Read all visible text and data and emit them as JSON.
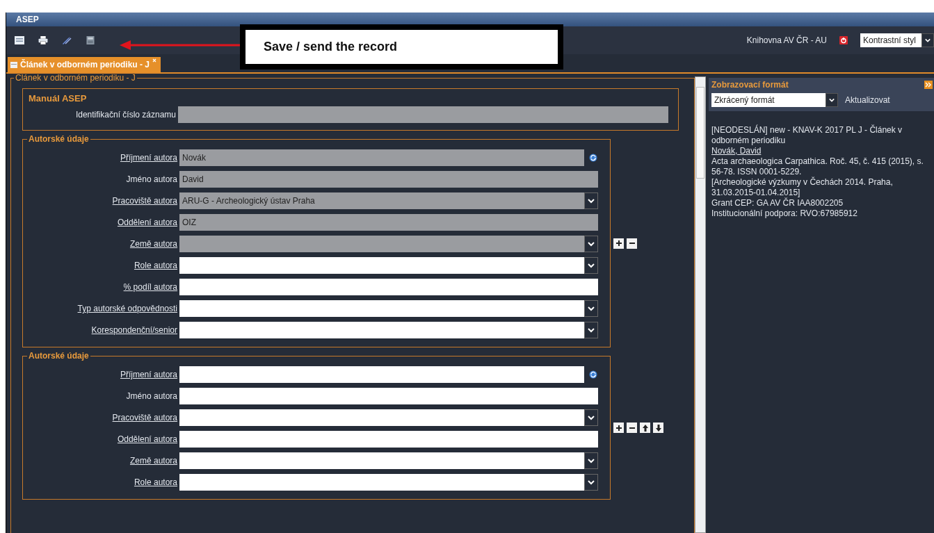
{
  "window": {
    "title": "ASEP"
  },
  "toolbar": {
    "library": "Knihovna AV ČR - AU",
    "style_select": {
      "value": "Kontrastní styl"
    }
  },
  "annotation": {
    "text": "Save / send the record"
  },
  "tabs": [
    {
      "label": "Článek v odborném periodiku - J",
      "selected": true
    }
  ],
  "form": {
    "title": "Článek v odborném periodiku - J",
    "manual": {
      "heading": "Manuál ASEP",
      "fields": [
        {
          "label": "Identifikační číslo záznamu",
          "kind": "text",
          "link": false,
          "disabled": true
        }
      ]
    },
    "sections": [
      {
        "legend": "Autorské údaje",
        "actions": [
          {
            "kind": "add"
          },
          {
            "kind": "remove"
          }
        ],
        "fields": [
          {
            "label": "Příjmení autora",
            "value": "Novák",
            "kind": "lookup",
            "link": true,
            "disabled": true
          },
          {
            "label": "Jméno autora",
            "value": "David",
            "kind": "text",
            "link": false,
            "disabled": true
          },
          {
            "label": "Pracoviště autora",
            "value": "ARU-G - Archeologický ústav Praha",
            "kind": "select",
            "link": true,
            "disabled": true
          },
          {
            "label": "Oddělení autora",
            "value": "OIZ",
            "kind": "text",
            "link": true,
            "disabled": true
          },
          {
            "label": "Země autora",
            "kind": "select",
            "link": true,
            "disabled": true
          },
          {
            "label": "Role autora",
            "kind": "select",
            "link": true,
            "disabled": false
          },
          {
            "label": "% podíl autora",
            "kind": "text",
            "link": true,
            "disabled": false
          },
          {
            "label": "Typ autorské odpovědnosti",
            "kind": "select",
            "link": true,
            "disabled": false
          },
          {
            "label": "Korespondenční/senior",
            "kind": "select",
            "link": true,
            "disabled": false
          }
        ]
      },
      {
        "legend": "Autorské údaje",
        "actions": [
          {
            "kind": "add"
          },
          {
            "kind": "remove"
          },
          {
            "kind": "up"
          },
          {
            "kind": "down"
          }
        ],
        "fields": [
          {
            "label": "Příjmení autora",
            "kind": "lookup",
            "link": true,
            "disabled": false
          },
          {
            "label": "Jméno autora",
            "kind": "text",
            "link": false,
            "disabled": false
          },
          {
            "label": "Pracoviště autora",
            "kind": "select",
            "link": true,
            "disabled": false
          },
          {
            "label": "Oddělení autora",
            "kind": "text",
            "link": true,
            "disabled": false
          },
          {
            "label": "Země autora",
            "kind": "select",
            "link": true,
            "disabled": false
          },
          {
            "label": "Role autora",
            "kind": "select",
            "link": true,
            "disabled": false
          }
        ]
      }
    ]
  },
  "preview": {
    "title": "Zobrazovací formát",
    "format_select": {
      "value": "Zkrácený formát"
    },
    "update_button": "Aktualizovat",
    "lines": [
      {
        "kind": "text",
        "text": "[NEODESLÁN] new - KNAV-K 2017 PL J - Článek v odborném periodiku"
      },
      {
        "kind": "link",
        "text": "Novák, David"
      },
      {
        "kind": "text",
        "text": "Acta archaeologica Carpathica. Roč. 45, č. 415 (2015), s. 56-78. ISSN 0001-5229."
      },
      {
        "kind": "text",
        "text": "[Archeologické výzkumy v Čechách 2014. Praha, 31.03.2015-01.04.2015]"
      },
      {
        "kind": "text",
        "text": "Grant CEP: GA AV ČR IAA8002205"
      },
      {
        "kind": "text",
        "text": "Institucionální podpora: RVO:67985912"
      }
    ]
  }
}
